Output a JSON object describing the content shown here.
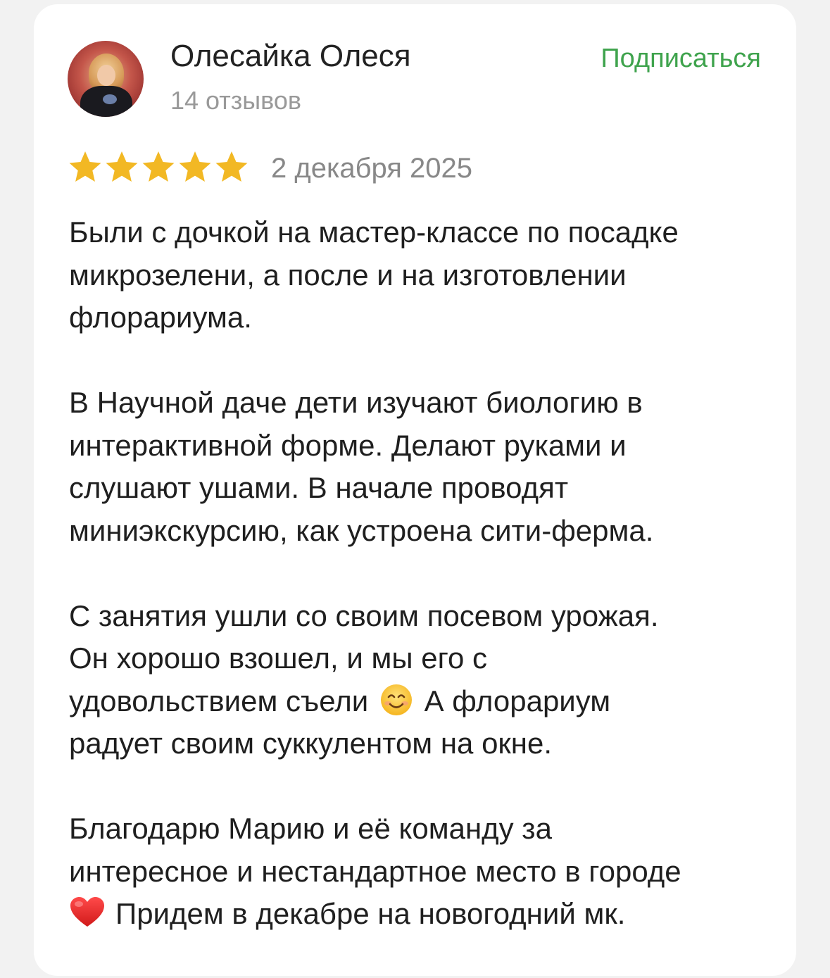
{
  "review": {
    "author_name": "Олесайка Олеся",
    "review_count": "14 отзывов",
    "subscribe_label": "Подписаться",
    "rating": 5,
    "rating_max": 5,
    "date": "2 декабря 2025",
    "star_color": "#f2b824",
    "accent_color": "#3fa34d",
    "paragraphs": [
      {
        "lines": [
          "Были с дочкой на мастер-классе по посадке",
          "микрозелени, а после и на изготовлении",
          "флорариума."
        ]
      },
      {
        "lines": [
          "В Научной даче дети изучают биологию в",
          "интерактивной форме. Делают руками и",
          "слушают ушами. В начале проводят",
          "миниэкскурсию, как устроена сити-ферма."
        ]
      },
      {
        "lines": [
          "С занятия ушли со своим посевом урожая.",
          "Он хорошо взошел, и мы его с",
          "удовольствием съели",
          "А флорариум",
          "радует своим суккулентом на окне."
        ],
        "emoji": "smiling-face-emoji"
      },
      {
        "lines": [
          "Благодарю Марию и её команду за",
          "интересное и нестандартное место в городе",
          "Придем в декабре на новогодний мк."
        ],
        "emoji": "red-heart-emoji"
      }
    ]
  }
}
